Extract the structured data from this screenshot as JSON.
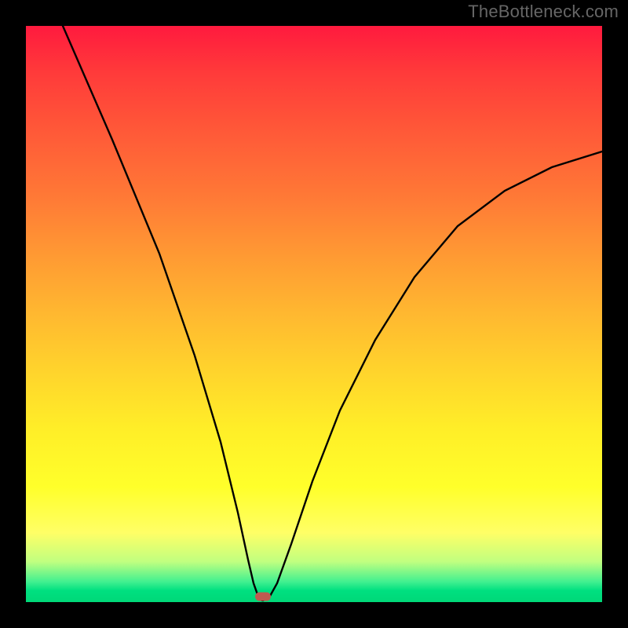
{
  "watermark": "TheBottleneck.com",
  "chart_data": {
    "type": "line",
    "title": "",
    "xlabel": "",
    "ylabel": "",
    "xlim": [
      0,
      100
    ],
    "ylim": [
      0,
      100
    ],
    "background_gradient": {
      "top": "#ff1a3e",
      "mid": "#ffee28",
      "bottom": "#00d878"
    },
    "curve": {
      "description": "V-shaped bottleneck curve; left branch steep descending, right branch rising convex",
      "minimum": {
        "x": 40,
        "y": 0
      },
      "points_approx": [
        {
          "x": 6,
          "y": 100
        },
        {
          "x": 12,
          "y": 82
        },
        {
          "x": 18,
          "y": 64
        },
        {
          "x": 24,
          "y": 47
        },
        {
          "x": 30,
          "y": 30
        },
        {
          "x": 35,
          "y": 14
        },
        {
          "x": 38,
          "y": 3
        },
        {
          "x": 40,
          "y": 0
        },
        {
          "x": 42,
          "y": 2
        },
        {
          "x": 46,
          "y": 12
        },
        {
          "x": 52,
          "y": 28
        },
        {
          "x": 60,
          "y": 45
        },
        {
          "x": 70,
          "y": 59
        },
        {
          "x": 80,
          "y": 68
        },
        {
          "x": 90,
          "y": 74
        },
        {
          "x": 100,
          "y": 78
        }
      ]
    },
    "marker": {
      "x": 40,
      "y": 0,
      "color": "#c05a50",
      "shape": "rounded-rect"
    }
  }
}
